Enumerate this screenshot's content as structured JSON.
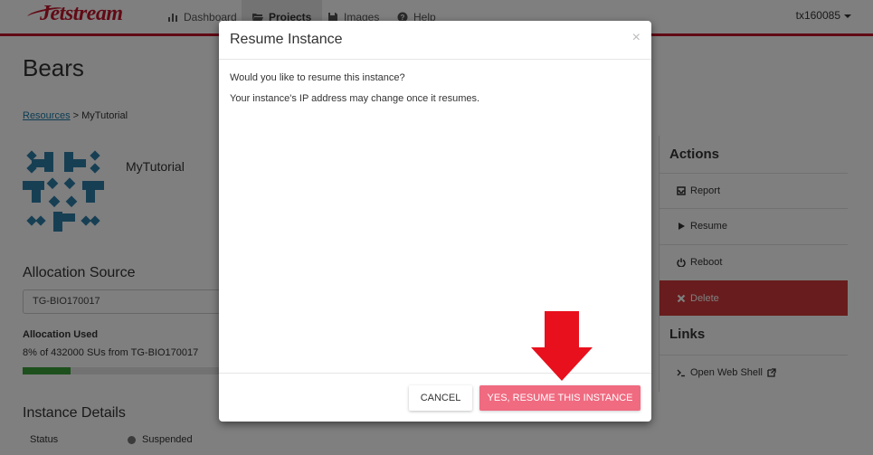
{
  "nav": {
    "brand": "Jetstream",
    "items": [
      {
        "label": "Dashboard",
        "icon": "dashboard-icon"
      },
      {
        "label": "Projects",
        "icon": "folder-open-icon",
        "active": true
      },
      {
        "label": "Images",
        "icon": "floppy-disk-icon"
      },
      {
        "label": "Help",
        "icon": "question-circle-icon"
      }
    ],
    "user": "tx160085"
  },
  "page": {
    "title": "Bears",
    "breadcrumb": {
      "link": "Resources",
      "separator": " > ",
      "current": "MyTutorial"
    },
    "instance_name": "MyTutorial"
  },
  "allocation": {
    "heading": "Allocation Source",
    "selected": "TG-BIO170017",
    "used_label": "Allocation Used",
    "used_text": "8% of 432000 SUs from TG-BIO170017",
    "used_fraction": 0.08
  },
  "details": {
    "heading": "Instance Details",
    "status_label": "Status",
    "status_value": "Suspended"
  },
  "actions": {
    "heading": "Actions",
    "items": [
      {
        "label": "Report",
        "icon": "inbox-icon"
      },
      {
        "label": "Resume",
        "icon": "play-icon"
      },
      {
        "label": "Reboot",
        "icon": "power-icon"
      },
      {
        "label": "Delete",
        "icon": "close-icon",
        "style": "danger"
      }
    ],
    "links_heading": "Links",
    "links": [
      {
        "label": "Open Web Shell",
        "icon": "terminal-icon",
        "trailing_icon": "external-link-icon"
      }
    ]
  },
  "modal": {
    "title": "Resume Instance",
    "close_glyph": "×",
    "body_line1": "Would you like to resume this instance?",
    "body_line2": "Your instance's IP address may change once it resumes.",
    "cancel_label": "CANCEL",
    "confirm_label": "YES, RESUME THIS INSTANCE"
  },
  "colors": {
    "brand": "#c2152b",
    "danger": "#d0393a",
    "confirm_button": "#f06a80",
    "link": "#1a7ba6",
    "progress": "#3aa13a",
    "arrow": "#e8101c"
  }
}
